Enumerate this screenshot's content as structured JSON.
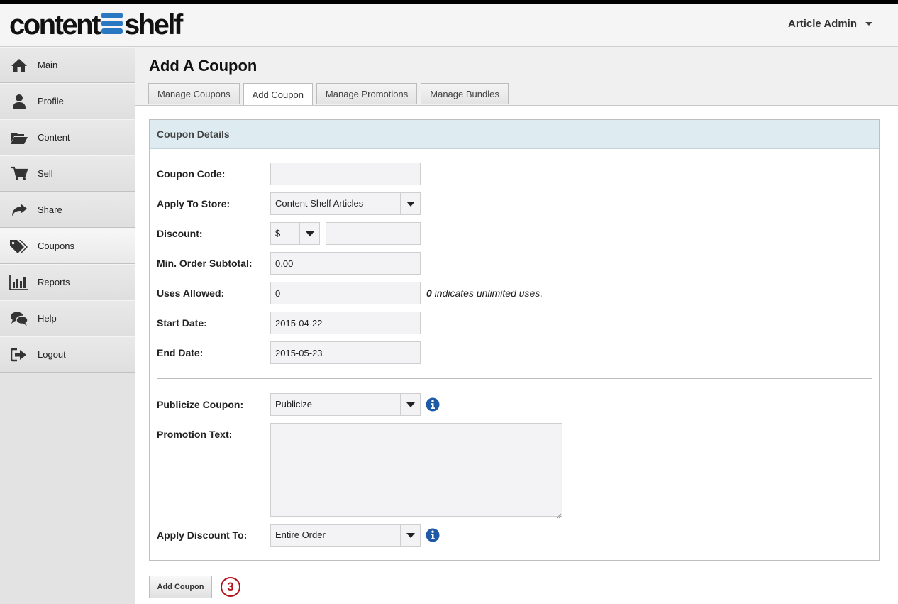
{
  "header": {
    "logo_left": "content",
    "logo_right": "shelf",
    "user_name": "Article Admin"
  },
  "sidebar": {
    "items": [
      {
        "label": "Main",
        "icon": "home-icon"
      },
      {
        "label": "Profile",
        "icon": "user-icon"
      },
      {
        "label": "Content",
        "icon": "folder-open-icon"
      },
      {
        "label": "Sell",
        "icon": "cart-icon"
      },
      {
        "label": "Share",
        "icon": "share-arrow-icon"
      },
      {
        "label": "Coupons",
        "icon": "tags-icon",
        "active": true
      },
      {
        "label": "Reports",
        "icon": "bar-chart-icon"
      },
      {
        "label": "Help",
        "icon": "chat-bubbles-icon"
      },
      {
        "label": "Logout",
        "icon": "sign-out-icon"
      }
    ]
  },
  "page": {
    "title": "Add A Coupon",
    "tabs": [
      {
        "label": "Manage Coupons"
      },
      {
        "label": "Add Coupon",
        "active": true
      },
      {
        "label": "Manage Promotions"
      },
      {
        "label": "Manage Bundles"
      }
    ]
  },
  "form": {
    "panel_title": "Coupon Details",
    "coupon_code_label": "Coupon Code:",
    "coupon_code_value": "",
    "store_label": "Apply To Store:",
    "store_value": "Content Shelf Articles",
    "discount_label": "Discount:",
    "discount_type": "$",
    "discount_value": "",
    "min_subtotal_label": "Min. Order Subtotal:",
    "min_subtotal_value": "0.00",
    "uses_label": "Uses Allowed:",
    "uses_value": "0",
    "uses_hint_bold": "0",
    "uses_hint_text": " indicates unlimited uses.",
    "start_label": "Start Date:",
    "start_value": "2015-04-22",
    "end_label": "End Date:",
    "end_value": "2015-05-23",
    "publicize_label": "Publicize Coupon:",
    "publicize_value": "Publicize",
    "promo_text_label": "Promotion Text:",
    "promo_text_value": "",
    "apply_discount_label": "Apply Discount To:",
    "apply_discount_value": "Entire Order"
  },
  "actions": {
    "submit_label": "Add Coupon",
    "step_badge": "3"
  },
  "colors": {
    "panel_header_bg": "#deebf0",
    "logo_blue": "#2b78c2",
    "info_blue": "#1f5aa6",
    "badge_red": "#b3121e"
  }
}
